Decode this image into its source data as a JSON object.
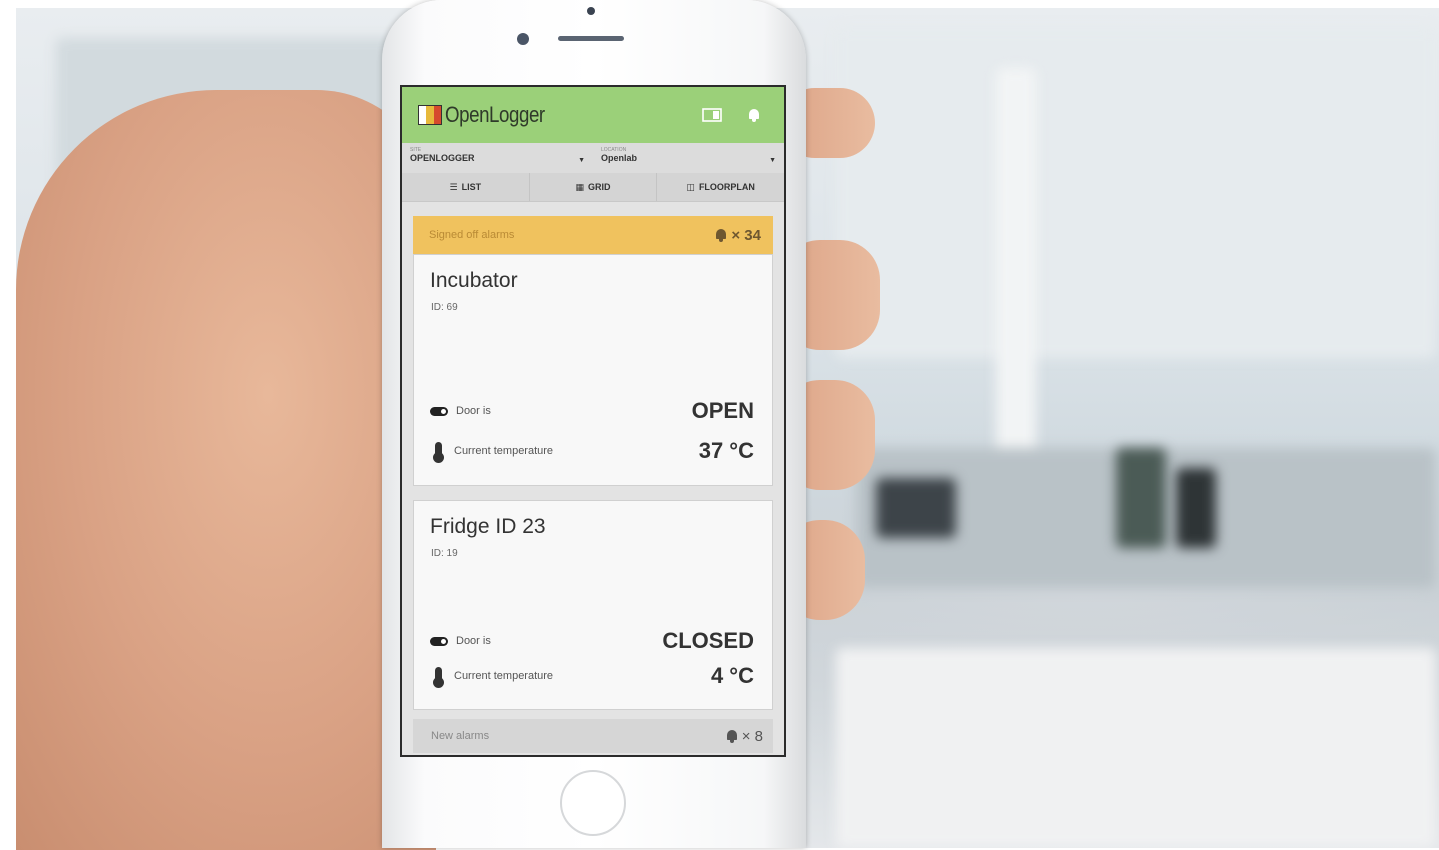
{
  "app": {
    "logo_text": "OpenLogger"
  },
  "header": {
    "icons": [
      "panel-icon",
      "bell-icon"
    ]
  },
  "selectors": {
    "site_label": "SITE",
    "site_value": "OPENLOGGER",
    "location_label": "LOCATION",
    "location_value": "Openlab"
  },
  "tabs": [
    {
      "label": "LIST",
      "icon": "list-icon"
    },
    {
      "label": "GRID",
      "icon": "grid-icon"
    },
    {
      "label": "FLOORPLAN",
      "icon": "floorplan-icon"
    }
  ],
  "signed_off_alarms": {
    "label": "Signed off alarms",
    "count": "× 34"
  },
  "devices": [
    {
      "name": "Incubator",
      "id_line": "ID: 69",
      "door_label": "Door is",
      "door_value": "OPEN",
      "temp_label": "Current temperature",
      "temp_value": "37 °C"
    },
    {
      "name": "Fridge ID 23",
      "id_line": "ID: 19",
      "door_label": "Door is",
      "door_value": "CLOSED",
      "temp_label": "Current temperature",
      "temp_value": "4 °C"
    }
  ],
  "new_alarms": {
    "label": "New alarms",
    "count": "× 8"
  },
  "colors": {
    "header_green": "#9bd079",
    "alarm_orange": "#f0c25e"
  }
}
